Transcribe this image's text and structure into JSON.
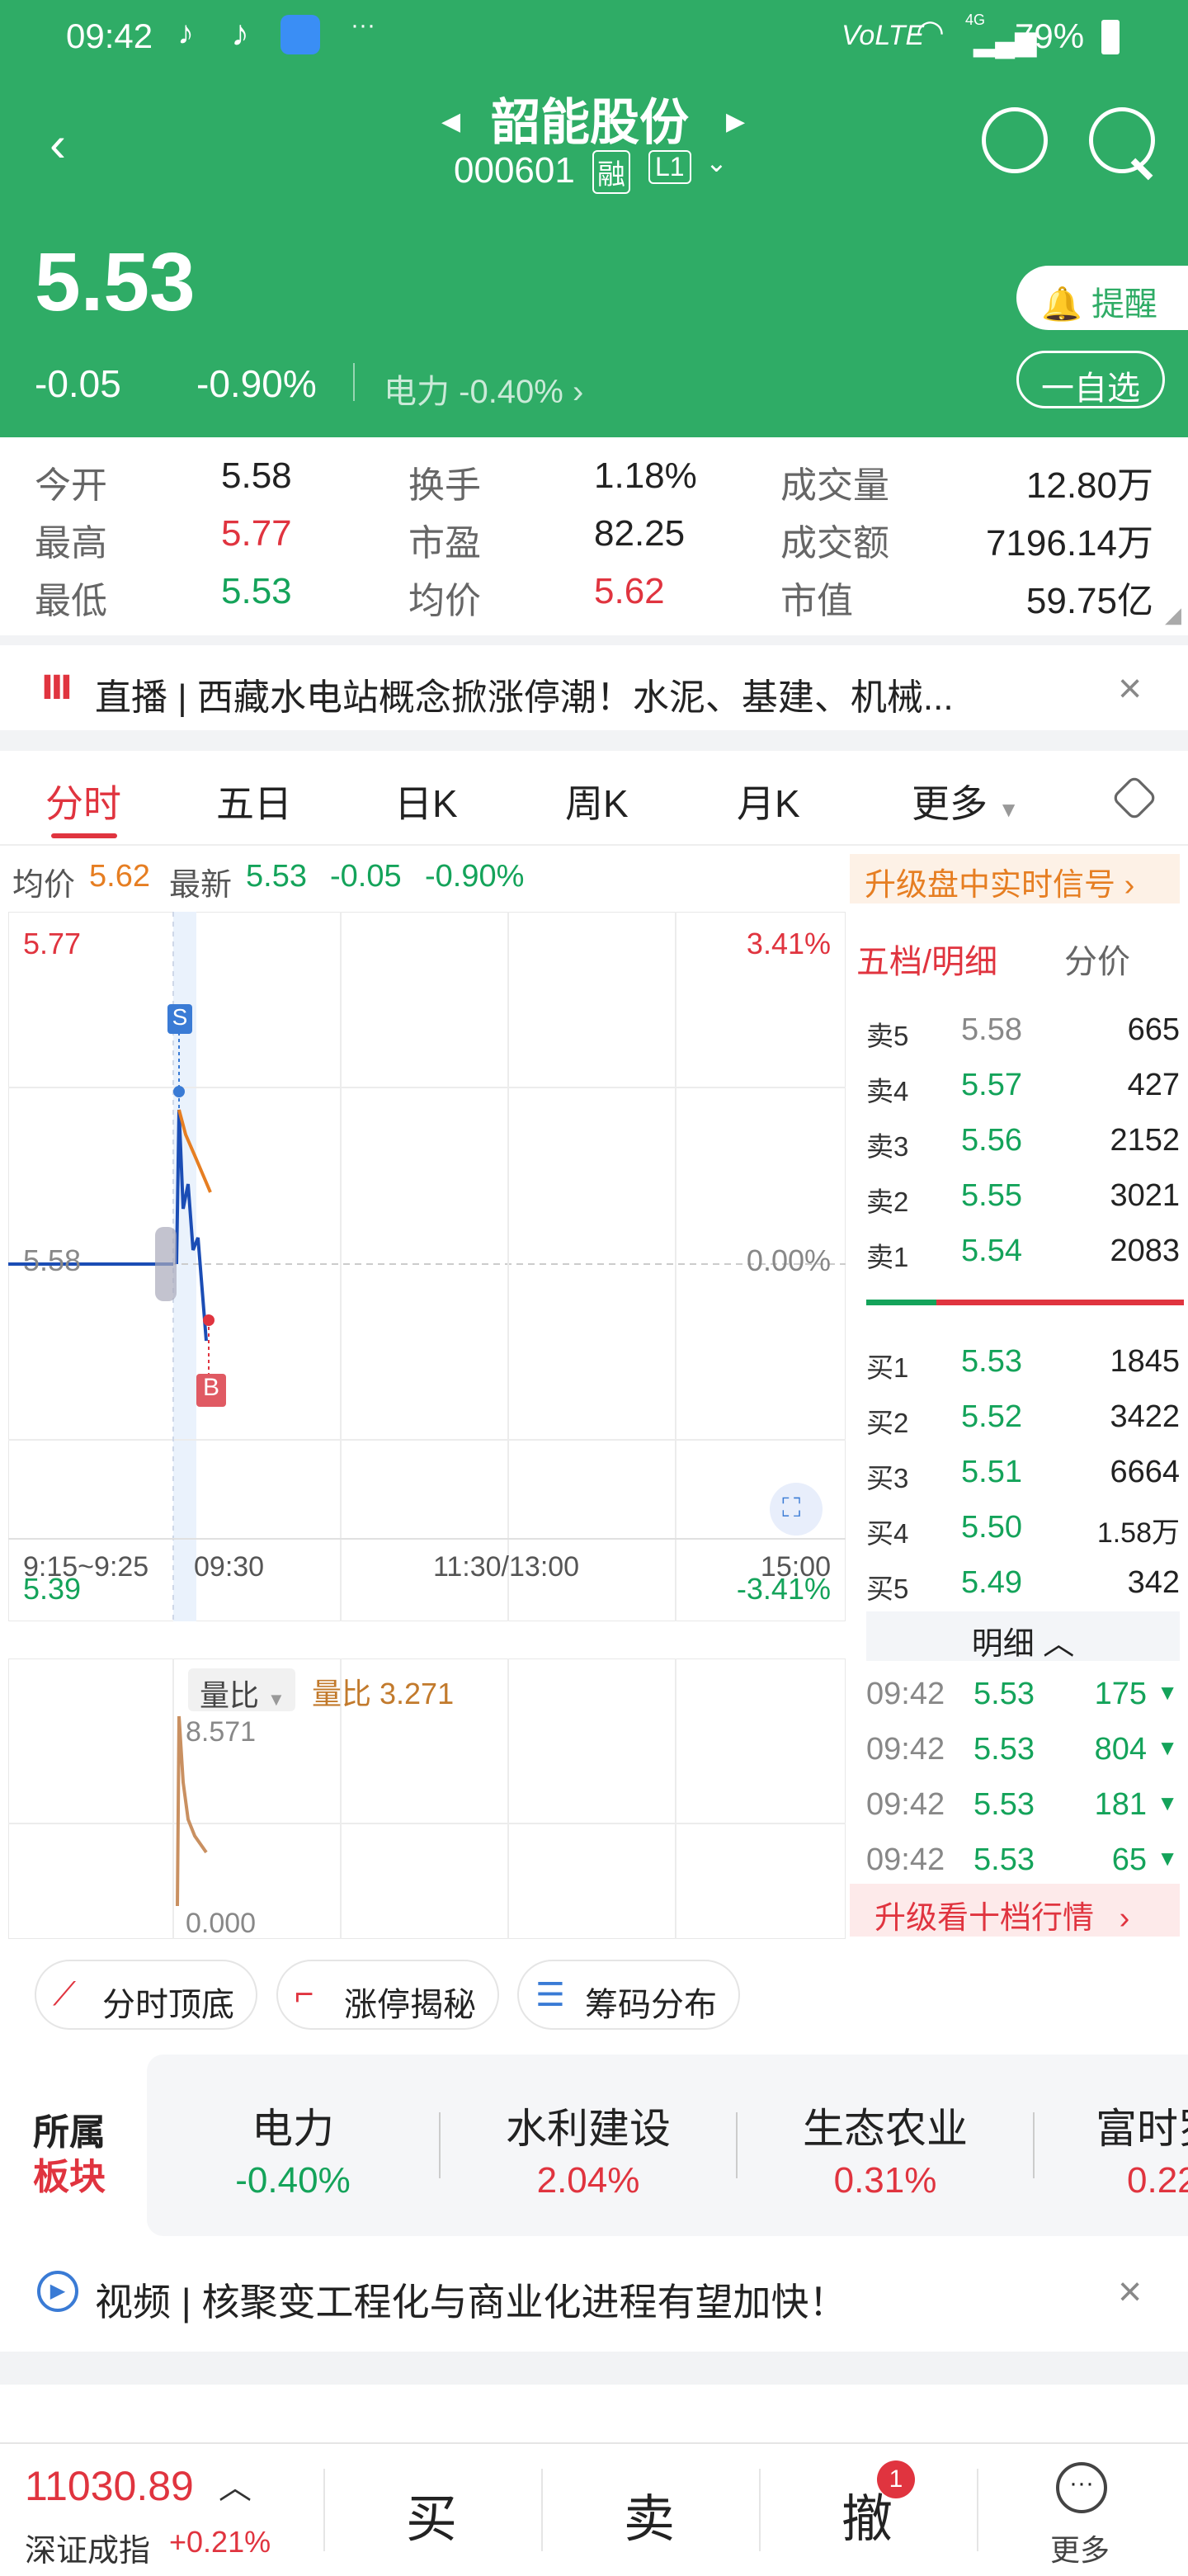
{
  "status_bar": {
    "time": "09:42",
    "network": "VoLTE",
    "signal": "4G",
    "battery": "79%"
  },
  "header": {
    "stock_name": "韶能股份",
    "stock_code": "000601",
    "badge_margin": "融",
    "badge_level": "L1",
    "price": "5.53",
    "change": "-0.05",
    "change_pct": "-0.90%",
    "sector_name": "电力",
    "sector_pct": "-0.40%",
    "remind_label": "提醒",
    "watchlist_label": "一自选"
  },
  "quote": {
    "labels": [
      "今开",
      "最高",
      "最低",
      "换手",
      "市盈",
      "均价",
      "成交量",
      "成交额",
      "市值"
    ],
    "values": [
      "5.58",
      "5.77",
      "5.53",
      "1.18%",
      "82.25",
      "5.62",
      "12.80万",
      "7196.14万",
      "59.75亿"
    ]
  },
  "news1": {
    "text": "直播 | 西藏水电站概念掀涨停潮！水泥、基建、机械..."
  },
  "tabs": [
    "分时",
    "五日",
    "日K",
    "周K",
    "月K",
    "更多"
  ],
  "summary": {
    "avg_label": "均价",
    "avg": "5.62",
    "last_label": "最新",
    "last": "5.53",
    "chg": "-0.05",
    "pct": "-0.90%",
    "upgrade": "升级盘中实时信号"
  },
  "chart": {
    "high": "5.77",
    "mid": "5.58",
    "low": "5.39",
    "pct_high": "3.41%",
    "pct_mid": "0.00%",
    "pct_low": "-3.41%",
    "times": [
      "9:15~9:25",
      "09:30",
      "11:30/13:00",
      "15:00"
    ],
    "marker_s": "S",
    "marker_b": "B"
  },
  "volume": {
    "label": "量比",
    "value_label": "量比 3.271",
    "max": "8.571",
    "min": "0.000"
  },
  "orderbook": {
    "title": "五档/明细",
    "subtitle": "分价",
    "asks": [
      {
        "label": "卖5",
        "price": "5.58",
        "qty": "665"
      },
      {
        "label": "卖4",
        "price": "5.57",
        "qty": "427"
      },
      {
        "label": "卖3",
        "price": "5.56",
        "qty": "2152"
      },
      {
        "label": "卖2",
        "price": "5.55",
        "qty": "3021"
      },
      {
        "label": "卖1",
        "price": "5.54",
        "qty": "2083"
      }
    ],
    "bids": [
      {
        "label": "买1",
        "price": "5.53",
        "qty": "1845"
      },
      {
        "label": "买2",
        "price": "5.52",
        "qty": "3422"
      },
      {
        "label": "买3",
        "price": "5.51",
        "qty": "6664"
      },
      {
        "label": "买4",
        "price": "5.50",
        "qty": "1.58万"
      },
      {
        "label": "买5",
        "price": "5.49",
        "qty": "342"
      }
    ],
    "detail_label": "明细",
    "details": [
      {
        "time": "09:42",
        "price": "5.53",
        "qty": "175"
      },
      {
        "time": "09:42",
        "price": "5.53",
        "qty": "804"
      },
      {
        "time": "09:42",
        "price": "5.53",
        "qty": "181"
      },
      {
        "time": "09:42",
        "price": "5.53",
        "qty": "65"
      }
    ],
    "upgrade": "升级看十档行情"
  },
  "buttons": [
    "分时顶底",
    "涨停揭秘",
    "筹码分布"
  ],
  "sector": {
    "title1": "所属",
    "title2": "板块",
    "items": [
      {
        "name": "电力",
        "pct": "-0.40%"
      },
      {
        "name": "水利建设",
        "pct": "2.04%"
      },
      {
        "name": "生态农业",
        "pct": "0.31%"
      },
      {
        "name": "富时罗",
        "pct": "0.22"
      }
    ]
  },
  "news2": {
    "text": "视频 | 核聚变工程化与商业化进程有望加快！"
  },
  "bottom": {
    "index_value": "11030.89",
    "index_name": "深证成指",
    "index_pct": "+0.21%",
    "buy": "买",
    "sell": "卖",
    "cancel": "撤",
    "cancel_badge": "1",
    "more": "更多"
  }
}
